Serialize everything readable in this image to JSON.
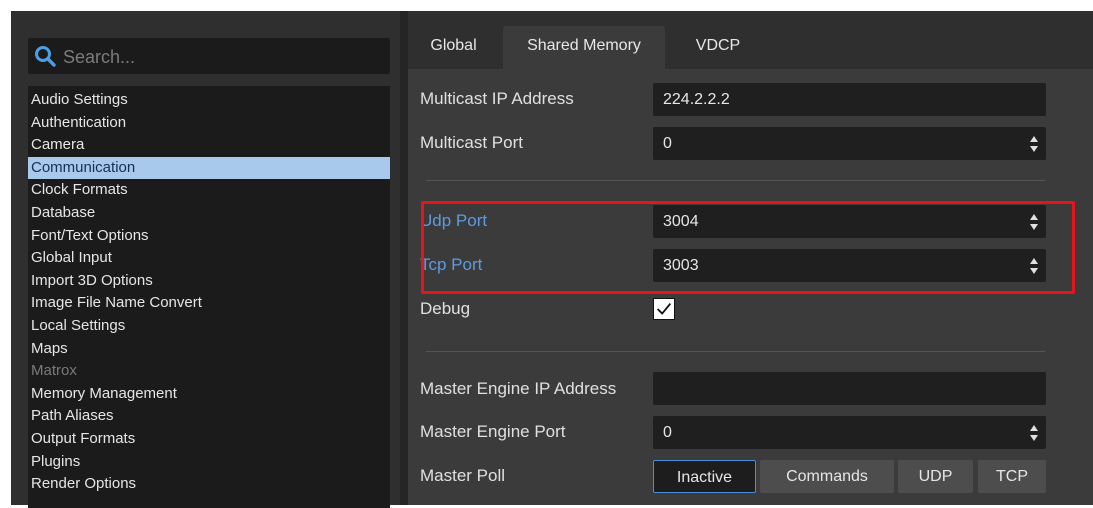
{
  "search": {
    "placeholder": "Search..."
  },
  "categories": [
    "Audio Settings",
    "Authentication",
    "Camera",
    "Communication",
    "Clock Formats",
    "Database",
    "Font/Text Options",
    "Global Input",
    "Import 3D Options",
    "Image File Name Convert",
    "Local Settings",
    "Maps",
    "Matrox",
    "Memory Management",
    "Path Aliases",
    "Output Formats",
    "Plugins",
    "Render Options"
  ],
  "tabs": [
    "Global",
    "Shared Memory",
    "VDCP"
  ],
  "form": {
    "multicast_ip_label": "Multicast IP Address",
    "multicast_ip_value": "224.2.2.2",
    "multicast_port_label": "Multicast Port",
    "multicast_port_value": "0",
    "udp_port_label": "Udp Port",
    "udp_port_value": "3004",
    "tcp_port_label": "Tcp Port",
    "tcp_port_value": "3003",
    "debug_label": "Debug",
    "debug_checked": true,
    "master_ip_label": "Master Engine IP Address",
    "master_ip_value": "",
    "master_port_label": "Master Engine Port",
    "master_port_value": "0",
    "master_poll_label": "Master Poll",
    "master_poll_options": [
      "Inactive",
      "Commands",
      "UDP",
      "TCP"
    ],
    "master_poll_selected": "Inactive"
  },
  "colors": {
    "selection": "#a9c9ec",
    "accent_label": "#5d9be0",
    "highlight_border": "#e8141c",
    "active_option_border": "#4a8fd6"
  }
}
